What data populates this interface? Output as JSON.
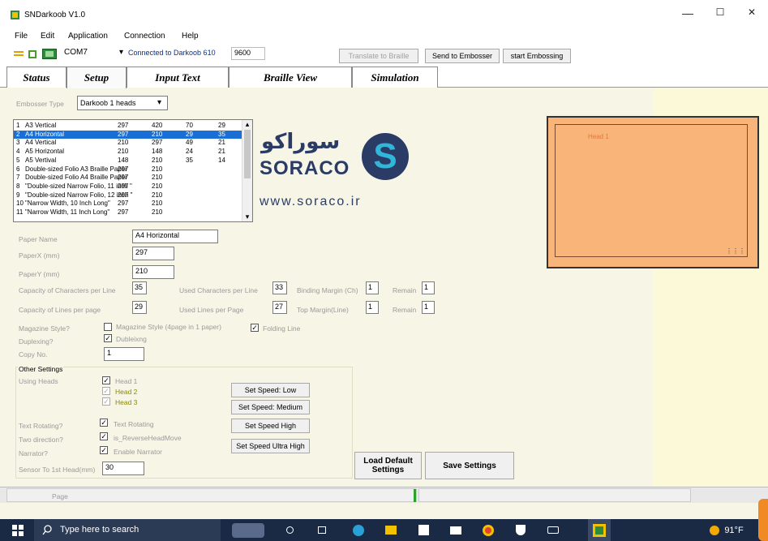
{
  "window": {
    "title": "SNDarkoob V1.0",
    "minimize": "—",
    "maximize": "☐",
    "close": "✕"
  },
  "menu": [
    "File",
    "Edit",
    "Application",
    "Connection",
    "Help"
  ],
  "toolbar": {
    "port": "COM7",
    "port_arrow": "▾",
    "connection_status": "Connected to Darkoob 610",
    "baud": "9600",
    "translate_btn": "Translate to Braille",
    "send_btn": "Send to Embosser",
    "start_btn": "start Embossing"
  },
  "tabs": [
    "Status",
    "Setup",
    "Input Text",
    "Braille View",
    "Simulation"
  ],
  "embosser": {
    "label": "Embosser Type",
    "value": "Darkoob 1 heads"
  },
  "paper_list": {
    "rows": [
      [
        "1",
        "A3 Vertical",
        "297",
        "420",
        "70",
        "29"
      ],
      [
        "2",
        "A4 Horizontal",
        "297",
        "210",
        "29",
        "35"
      ],
      [
        "3",
        "A4 Vertical",
        "210",
        "297",
        "49",
        "21"
      ],
      [
        "4",
        "A5 Horizontal",
        "210",
        "148",
        "24",
        "21"
      ],
      [
        "5",
        "A5 Vertival",
        "148",
        "210",
        "35",
        "14"
      ],
      [
        "6",
        "Double-sized Folio A3 Braille Paper",
        "297",
        "210",
        "",
        ""
      ],
      [
        "7",
        "Double-sized Folio A4 Braille Paper",
        "297",
        "210",
        "",
        ""
      ],
      [
        "8",
        "\"Double-sized Narrow Folio, 11 inch \"",
        "297",
        "210",
        "",
        ""
      ],
      [
        "9",
        "\"Double-sized Narrow Folio, 12 inch \"",
        "297",
        "210",
        "",
        ""
      ],
      [
        "10",
        "\"Narrow Width, 10 Inch Long\"",
        "297",
        "210",
        "",
        ""
      ],
      [
        "11",
        "\"Narrow Width, 11 Inch Long\"",
        "297",
        "210",
        "",
        ""
      ]
    ],
    "selected_index": 1,
    "scroll_up": "▴",
    "scroll_down": "▾"
  },
  "logo": {
    "persian": "سوراکو",
    "latin": "SORACO",
    "url": "www.soraco.ir",
    "mark": "S"
  },
  "paper": {
    "name_label": "Paper Name",
    "name_value": "A4 Horizontal",
    "x_label": "PaperX (mm)",
    "x_value": "297",
    "y_label": "PaperY (mm)",
    "y_value": "210"
  },
  "capacity": {
    "chars_label": "Capacity of Characters per Line",
    "chars_value": "35",
    "lines_label": "Capacity of Lines per page",
    "lines_value": "29",
    "used_chars_label": "Used Characters per Line",
    "used_chars_value": "33",
    "used_lines_label": "Used Lines per Page",
    "used_lines_value": "27",
    "binding_label": "Binding Margin (Ch)",
    "binding_value": "1",
    "top_label": "Top Margin(Line)",
    "top_value": "1",
    "remain1_label": "Remain",
    "remain1_value": "1",
    "remain2_label": "Remain",
    "remain2_value": "1"
  },
  "options": {
    "magazine_label": "Magazine Style?",
    "magazine_chk": "Magazine Style (4page in 1 paper)",
    "folding_chk": "Folding Line",
    "duplex_label": "Duplexing?",
    "duplex_chk": "Dubleixng",
    "copy_label": "Copy No.",
    "copy_value": "1"
  },
  "other": {
    "title": "Other Settings",
    "heads_label": "Using Heads",
    "head1": "Head 1",
    "head2": "Head 2",
    "head3": "Head 3",
    "speed_low": "Set Speed: Low",
    "speed_med": "Set Speed: Medium",
    "speed_high": "Set Speed High",
    "speed_ultra": "Set Speed Ultra High",
    "rot_label": "Text Rotating?",
    "rot_chk": "Text Rotating",
    "two_label": "Two direction?",
    "two_chk": "is_ReverseHeadMove",
    "narr_label": "Narrator?",
    "narr_chk": "Enable Narrator",
    "sensor_label": "Sensor To 1st Head(mm)",
    "sensor_value": "30",
    "check": "✓"
  },
  "buttons": {
    "load_default": "Load Default Settings",
    "save": "Save Settings"
  },
  "preview": {
    "head_label": "Head 1",
    "corner": "⋮⋮⋮"
  },
  "statusbar": {
    "page": "Page"
  },
  "taskbar": {
    "search": "Type here to search",
    "temp": "91°F"
  },
  "colors": {
    "accent": "#1a6fd6",
    "preview_fill": "#f9b47a",
    "panel_bg": "#f7f5e6",
    "taskbar": "#1b2a44",
    "progress": "#2ca02c"
  }
}
